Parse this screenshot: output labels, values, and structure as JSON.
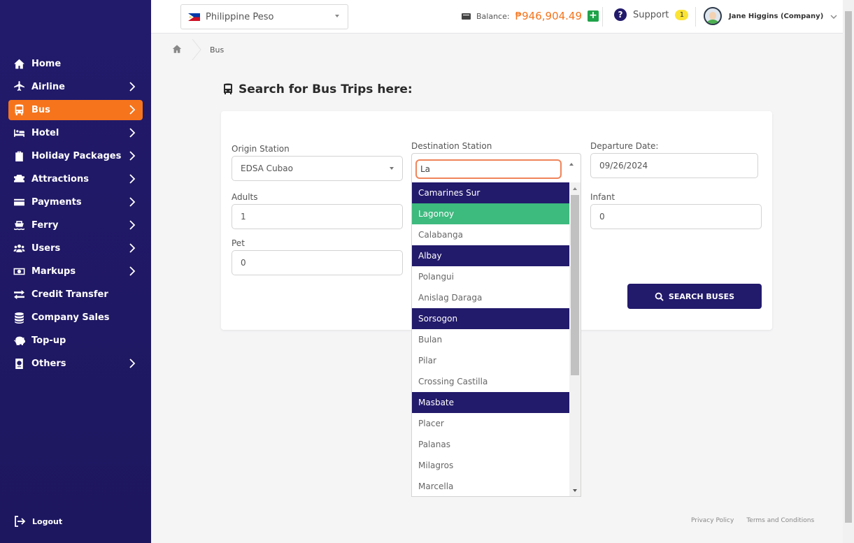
{
  "sidebar": {
    "items": [
      {
        "label": "Home",
        "icon": "home-icon",
        "has_children": false,
        "active": false
      },
      {
        "label": "Airline",
        "icon": "plane-icon",
        "has_children": true,
        "active": false
      },
      {
        "label": "Bus",
        "icon": "bus-icon",
        "has_children": true,
        "active": true
      },
      {
        "label": "Hotel",
        "icon": "bed-icon",
        "has_children": true,
        "active": false
      },
      {
        "label": "Holiday Packages",
        "icon": "suitcase-icon",
        "has_children": true,
        "active": false
      },
      {
        "label": "Attractions",
        "icon": "ticket-icon",
        "has_children": true,
        "active": false
      },
      {
        "label": "Payments",
        "icon": "credit-card-icon",
        "has_children": true,
        "active": false
      },
      {
        "label": "Ferry",
        "icon": "ferry-icon",
        "has_children": true,
        "active": false
      },
      {
        "label": "Users",
        "icon": "users-icon",
        "has_children": true,
        "active": false
      },
      {
        "label": "Markups",
        "icon": "money-bill-icon",
        "has_children": true,
        "active": false
      },
      {
        "label": "Credit Transfer",
        "icon": "transfer-icon",
        "has_children": false,
        "active": false
      },
      {
        "label": "Company Sales",
        "icon": "coins-icon",
        "has_children": false,
        "active": false
      },
      {
        "label": "Top-up",
        "icon": "piggy-bank-icon",
        "has_children": false,
        "active": false
      },
      {
        "label": "Others",
        "icon": "passport-icon",
        "has_children": true,
        "active": false
      }
    ],
    "logout_label": "Logout",
    "colors": {
      "background": "#221a6b",
      "active": "#f6741c"
    }
  },
  "header": {
    "currency": "Philippine Peso",
    "balance_label": "Balance:",
    "balance_value": "₱946,904.49",
    "support_label": "Support",
    "support_count": "1",
    "user_name": "Jane Higgins (Company)"
  },
  "breadcrumb": {
    "current": "Bus"
  },
  "page": {
    "title": "Search for Bus Trips here:"
  },
  "form": {
    "origin_label": "Origin Station",
    "origin_value": "EDSA Cubao",
    "destination_label": "Destination Station",
    "destination_query": "La",
    "departure_label": "Departure Date:",
    "departure_value": "09/26/2024",
    "adults_label": "Adults",
    "adults_value": "1",
    "infant_label": "Infant",
    "infant_value": "0",
    "pet_label": "Pet",
    "pet_value": "0",
    "search_button": "SEARCH BUSES"
  },
  "dropdown": {
    "options": [
      {
        "label": "Camarines Sur",
        "type": "group"
      },
      {
        "label": "Lagonoy",
        "type": "selected"
      },
      {
        "label": "Calabanga",
        "type": "option"
      },
      {
        "label": "Albay",
        "type": "group"
      },
      {
        "label": "Polangui",
        "type": "option"
      },
      {
        "label": "Anislag Daraga",
        "type": "option"
      },
      {
        "label": "Sorsogon",
        "type": "group"
      },
      {
        "label": "Bulan",
        "type": "option"
      },
      {
        "label": "Pilar",
        "type": "option"
      },
      {
        "label": "Crossing Castilla",
        "type": "option"
      },
      {
        "label": "Masbate",
        "type": "group"
      },
      {
        "label": "Placer",
        "type": "option"
      },
      {
        "label": "Palanas",
        "type": "option"
      },
      {
        "label": "Milagros",
        "type": "option"
      },
      {
        "label": "Marcella",
        "type": "option"
      }
    ],
    "colors": {
      "group": "#221a6b",
      "selected": "#3dba7e"
    }
  },
  "footer": {
    "privacy": "Privacy Policy",
    "terms": "Terms and Conditions"
  }
}
